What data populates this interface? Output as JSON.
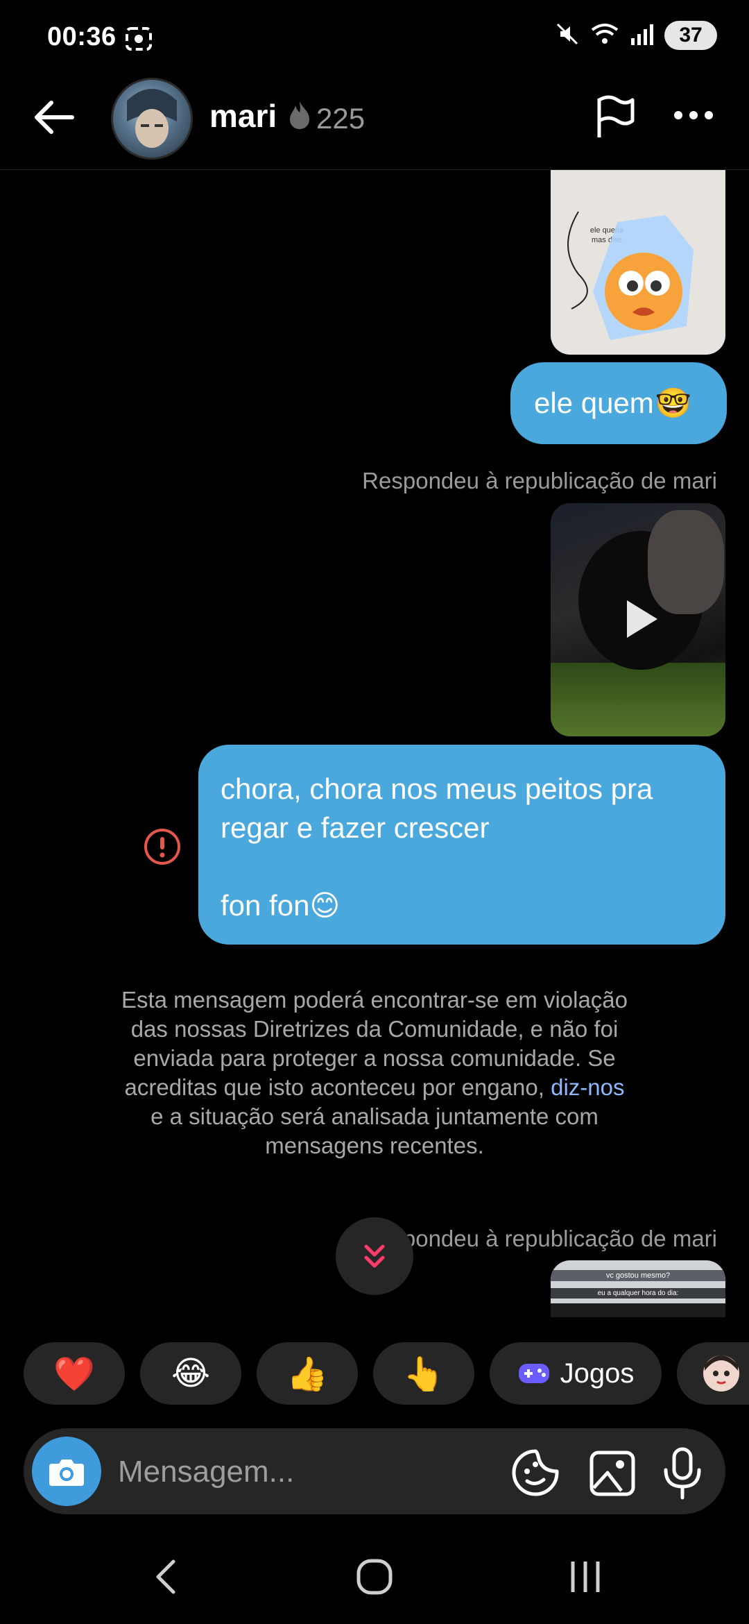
{
  "status_bar": {
    "time": "00:36",
    "battery": "37"
  },
  "header": {
    "username": "mari",
    "streak_count": "225"
  },
  "messages": {
    "text1": "ele quem",
    "reply_note_1": "Respondeu à republicação de mari",
    "text2_line1": "chora, chora nos meus peitos pra",
    "text2_line2": "regar e fazer crescer",
    "text2_line3": "fon fon",
    "warning_part1": "Esta mensagem poderá encontrar-se em violação das nossas Diretrizes da Comunidade, e não foi enviada para proteger a nossa comunidade. Se acreditas que isto aconteceu por engano,",
    "warning_link": "diz-nos",
    "warning_part2": "e a situação será analisada juntamente com mensagens recentes.",
    "reply_note_2": "Respondeu à republicação de mari",
    "media_thumb_1_text": "ele queria mas dise",
    "media_thumb_3_line1": "vc gostou mesmo?",
    "media_thumb_3_line2": "eu a qualquer hora do dia:"
  },
  "quick_reactions": [
    "❤️",
    "😂",
    "👍",
    "👆"
  ],
  "games_label": "Jogos",
  "composer": {
    "placeholder": "Mensagem..."
  }
}
